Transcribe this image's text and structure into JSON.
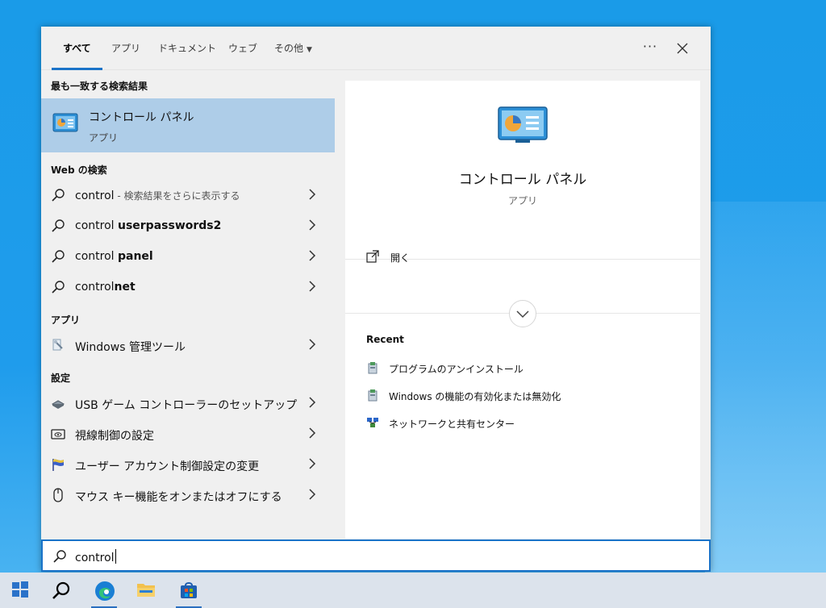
{
  "tabs": [
    {
      "label": "すべて",
      "active": true
    },
    {
      "label": "アプリ"
    },
    {
      "label": "ドキュメント"
    },
    {
      "label": "ウェブ"
    },
    {
      "label": "その他"
    }
  ],
  "toolbar": {
    "more_icon": "ellipsis-icon",
    "close_icon": "close-icon"
  },
  "sections": {
    "best_match": "最も一致する検索結果",
    "web": "Web の検索",
    "apps": "アプリ",
    "settings": "設定"
  },
  "best_match": {
    "title": "コントロール パネル",
    "subtitle": "アプリ",
    "icon": "control-panel-icon"
  },
  "web_results": [
    {
      "normal": "control",
      "bold": "",
      "hint": " - 検索結果をさらに表示する"
    },
    {
      "normal": "control ",
      "bold": "userpasswords2",
      "hint": ""
    },
    {
      "normal": "control ",
      "bold": "panel",
      "hint": ""
    },
    {
      "normal": "control",
      "bold": "net",
      "hint": ""
    }
  ],
  "apps": [
    {
      "label": "Windows 管理ツール",
      "icon": "admin-tools-icon"
    }
  ],
  "settings": [
    {
      "label": "USB ゲーム コントローラーのセットアップ",
      "icon": "game-controller-icon"
    },
    {
      "label": "視線制御の設定",
      "icon": "eye-control-icon"
    },
    {
      "label": "ユーザー アカウント制御設定の変更",
      "icon": "uac-flag-icon"
    },
    {
      "label": "マウス キー機能をオンまたはオフにする",
      "icon": "mouse-icon"
    }
  ],
  "preview": {
    "title": "コントロール パネル",
    "subtitle": "アプリ",
    "open_label": "開く",
    "recent_title": "Recent",
    "recent": [
      {
        "label": "プログラムのアンインストール",
        "icon": "programs-icon"
      },
      {
        "label": "Windows の機能の有効化または無効化",
        "icon": "programs-icon"
      },
      {
        "label": "ネットワークと共有センター",
        "icon": "network-icon"
      }
    ]
  },
  "search": {
    "value": "control"
  },
  "taskbar": [
    {
      "name": "start-button",
      "icon": "windows-logo-icon"
    },
    {
      "name": "search-button",
      "icon": "search-icon"
    },
    {
      "name": "edge-button",
      "icon": "edge-icon"
    },
    {
      "name": "explorer-button",
      "icon": "folder-icon"
    },
    {
      "name": "store-button",
      "icon": "store-icon"
    }
  ],
  "colors": {
    "accent": "#1a73c8",
    "selected": "#aecde8",
    "desktop": "#1f9cec"
  }
}
